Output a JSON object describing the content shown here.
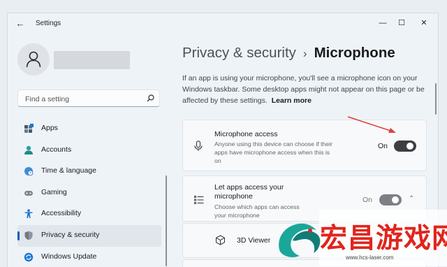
{
  "window": {
    "title": "Settings",
    "controls": {
      "minimize": "—",
      "maximize": "☐",
      "close": "✕"
    }
  },
  "search": {
    "placeholder": "Find a setting"
  },
  "sidebar": {
    "items": [
      {
        "label": "Apps",
        "icon": "apps-icon"
      },
      {
        "label": "Accounts",
        "icon": "accounts-icon"
      },
      {
        "label": "Time & language",
        "icon": "globe-clock-icon"
      },
      {
        "label": "Gaming",
        "icon": "gamepad-icon"
      },
      {
        "label": "Accessibility",
        "icon": "accessibility-icon"
      },
      {
        "label": "Privacy & security",
        "icon": "shield-icon",
        "selected": true
      },
      {
        "label": "Windows Update",
        "icon": "sync-icon"
      }
    ]
  },
  "breadcrumb": {
    "parent": "Privacy & security",
    "separator": "›",
    "current": "Microphone"
  },
  "description": {
    "text": "If an app is using your microphone, you'll see a microphone icon on your Windows taskbar. Some desktop apps might not appear on this page or be affected by these settings.",
    "link": "Learn more"
  },
  "microphone_access": {
    "title": "Microphone access",
    "subtitle": "Anyone using this device can choose if their apps have microphone access when this is on",
    "state_label": "On",
    "value": true
  },
  "apps_access": {
    "title": "Let apps access your microphone",
    "subtitle": "Choose which apps can access your microphone",
    "state_label": "On",
    "value": true
  },
  "app_list": [
    {
      "name": "3D Viewer"
    }
  ],
  "watermark": {
    "text": "宏昌游戏网",
    "url": "www.hcs-laser.com"
  },
  "colors": {
    "accent": "#005fb8",
    "annotation_arrow": "#d9453b",
    "watermark_red": "#e0251d"
  }
}
